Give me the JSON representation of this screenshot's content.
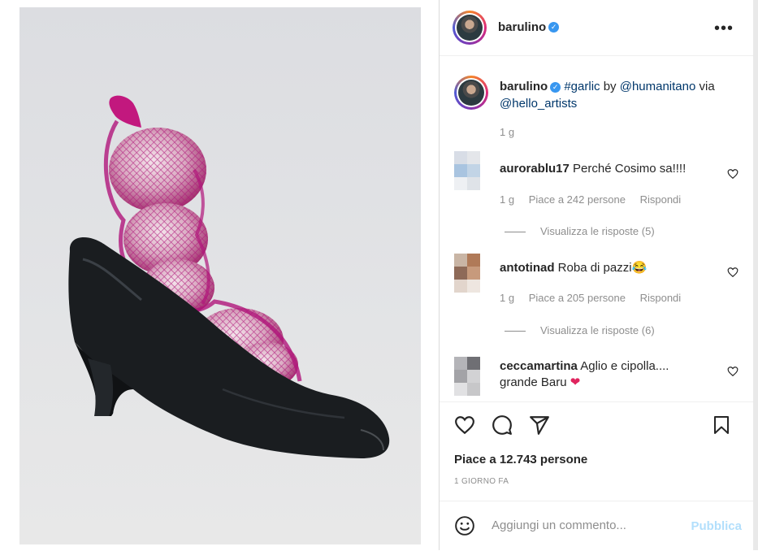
{
  "post": {
    "username": "barulino",
    "verified": true,
    "more_icon": "more-horizontal-icon",
    "image_alt_subject": "black high-heel shoe filled with garlic in pink mesh net"
  },
  "caption": {
    "username": "barulino",
    "hashtag": "#garlic",
    "by": "by",
    "mention_artist": "@humanitano",
    "via": "via",
    "mention_source": "@hello_artists",
    "time": "1 g"
  },
  "comments": [
    {
      "username": "aurorablu17",
      "text": "Perché Cosimo sa!!!!",
      "time": "1 g",
      "likes": "Piace a 242 persone",
      "reply": "Rispondi",
      "view_replies": "Visualizza le risposte (5)",
      "avatar_colors": [
        "#d8dde6",
        "#e4e6ea",
        "#a9c4e0",
        "#c2d4e6",
        "#eef0f3",
        "#dfe3e8"
      ]
    },
    {
      "username": "antotinad",
      "text": "Roba di pazzi😂",
      "time": "1 g",
      "likes": "Piace a 205 persone",
      "reply": "Rispondi",
      "view_replies": "Visualizza le risposte (6)",
      "avatar_colors": [
        "#c9b5a5",
        "#b07a58",
        "#8e6a58",
        "#c79a7c",
        "#e2d5cc",
        "#eee6e0"
      ]
    },
    {
      "username": "ceccamartina",
      "text": "Aglio e cipolla....",
      "text_line2": "grande Baru",
      "heart": "❤",
      "avatar_colors": [
        "#b4b4b8",
        "#6f6f74",
        "#a3a3a7",
        "#d2d2d4",
        "#e1e1e3",
        "#c7c7c9"
      ]
    }
  ],
  "actions": {
    "like_icon": "heart-icon",
    "comment_icon": "comment-icon",
    "share_icon": "send-icon",
    "save_icon": "bookmark-icon",
    "likes_text": "Piace a 12.743 persone",
    "date_text": "1 GIORNO FA"
  },
  "add_comment": {
    "emoji_icon": "emoji-icon",
    "placeholder": "Aggiungi un commento...",
    "publish_label": "Pubblica"
  },
  "colors": {
    "verified_blue": "#3897f0",
    "link": "#00376b",
    "secondary_text": "#8e8e8e",
    "publish_disabled": "#b2dffc",
    "heart_red": "#e0245e"
  }
}
